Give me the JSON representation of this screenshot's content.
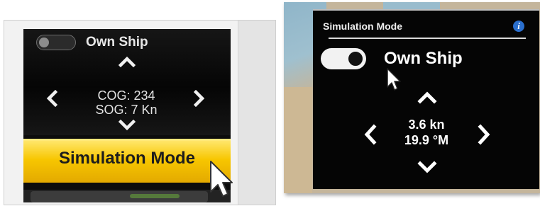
{
  "left_panel": {
    "toggle_label": "Own Ship",
    "readout_line1": "COG: 234",
    "readout_line2": "SOG: 7 Kn",
    "button_label": "Simulation Mode",
    "accent_color": "#f7c600",
    "toggle_state": "off"
  },
  "right_panel": {
    "title": "Simulation Mode",
    "info_icon": "i",
    "toggle_label": "Own Ship",
    "toggle_state": "on",
    "readout_line1": "3.6 kn",
    "readout_line2": "19.9 °M"
  },
  "icons": {
    "up": "chevron-up-icon",
    "down": "chevron-down-icon",
    "left": "chevron-left-icon",
    "right": "chevron-right-icon",
    "cursor": "mouse-pointer-icon",
    "info": "info-icon"
  }
}
